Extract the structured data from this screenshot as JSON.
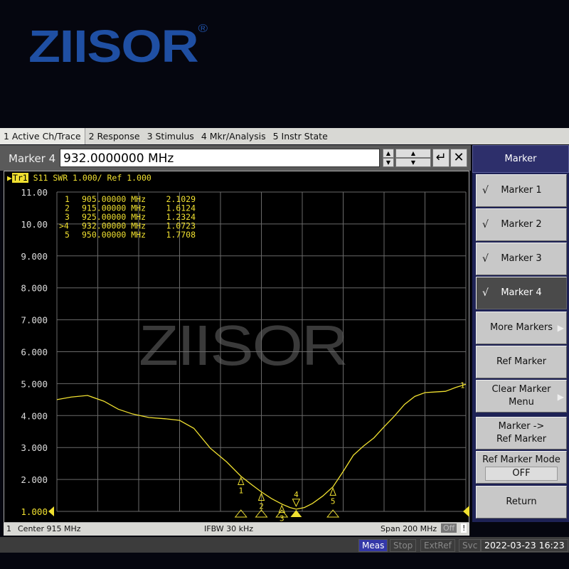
{
  "logo": {
    "text": "ZIISOR",
    "reg": "®"
  },
  "menubar": {
    "items": [
      "1 Active Ch/Trace",
      "2 Response",
      "3 Stimulus",
      "4 Mkr/Analysis",
      "5 Instr State"
    ]
  },
  "entry": {
    "label": "Marker 4",
    "value": "932.0000000 MHz"
  },
  "trace_header": {
    "trace": "Tr1",
    "text": "S11  SWR 1.000/ Ref 1.000"
  },
  "watermark": "ZIISOR",
  "marker_table": [
    {
      "id": "1",
      "freq": "905.00000 MHz",
      "value": "2.1029"
    },
    {
      "id": ">4",
      "freq": "932.00000 MHz",
      "value": "1.0723"
    }
  ],
  "status": {
    "channel": "1",
    "center": "Center 915 MHz",
    "ifbw": "IFBW 30 kHz",
    "span": "Span 200 MHz",
    "off": "Off",
    "bang": "!"
  },
  "bottom": {
    "meas": "Meas",
    "stop": "Stop",
    "extref": "ExtRef",
    "svc": "Svc",
    "datetime": "2022-03-23 16:23"
  },
  "softkeys": {
    "title": "Marker",
    "check": "√",
    "marker1": "Marker 1",
    "marker2": "Marker 2",
    "marker3": "Marker 3",
    "marker4": "Marker 4",
    "more": "More Markers",
    "ref_marker": "Ref Marker",
    "clear1": "Clear Marker",
    "clear2": "Menu",
    "mref1": "Marker ->",
    "mref2": "Ref Marker",
    "mode": "Ref Marker Mode",
    "mode_value": "OFF",
    "return": "Return"
  },
  "colors": {
    "trace": "#f0e030",
    "grid": "#6a6a6a",
    "softkey_header": "#2d2f6b"
  },
  "chart_data": {
    "type": "line",
    "xlim": [
      815,
      1015
    ],
    "x_unit": "MHz",
    "ylim": [
      1,
      11
    ],
    "yticks": [
      "11.00",
      "10.00",
      "9.000",
      "8.000",
      "7.000",
      "6.000",
      "5.000",
      "4.000",
      "3.000",
      "2.000",
      "1.000"
    ],
    "grid": true,
    "series": [
      {
        "x": [
          815,
          822,
          830,
          838,
          845,
          852,
          860,
          868,
          875,
          882,
          890,
          898,
          905,
          910,
          915,
          920,
          925,
          929,
          932,
          936,
          940,
          945,
          950,
          955,
          960,
          965,
          970,
          975,
          980,
          985,
          990,
          995,
          1000,
          1005,
          1010,
          1015
        ],
        "y": [
          4.5,
          4.58,
          4.63,
          4.45,
          4.2,
          4.05,
          3.94,
          3.9,
          3.85,
          3.6,
          2.98,
          2.55,
          2.1,
          1.85,
          1.61,
          1.4,
          1.23,
          1.12,
          1.07,
          1.12,
          1.25,
          1.48,
          1.77,
          2.25,
          2.76,
          3.05,
          3.3,
          3.65,
          3.98,
          4.35,
          4.6,
          4.72,
          4.74,
          4.76,
          4.88,
          4.98
        ]
      }
    ],
    "markers": [
      {
        "label": "1",
        "freq": "905.00000 MHz",
        "x": 905,
        "y": 2.1029
      },
      {
        "label": "2",
        "freq": "915.00000 MHz",
        "x": 915,
        "y": 1.6124
      },
      {
        "label": "3",
        "freq": "925.00000 MHz",
        "x": 925,
        "y": 1.2324
      },
      {
        "label": "4",
        "freq": "932.00000 MHz",
        "x": 932,
        "y": 1.0723,
        "active": true
      },
      {
        "label": "5",
        "freq": "950.00000 MHz",
        "x": 950,
        "y": 1.7708
      }
    ]
  }
}
